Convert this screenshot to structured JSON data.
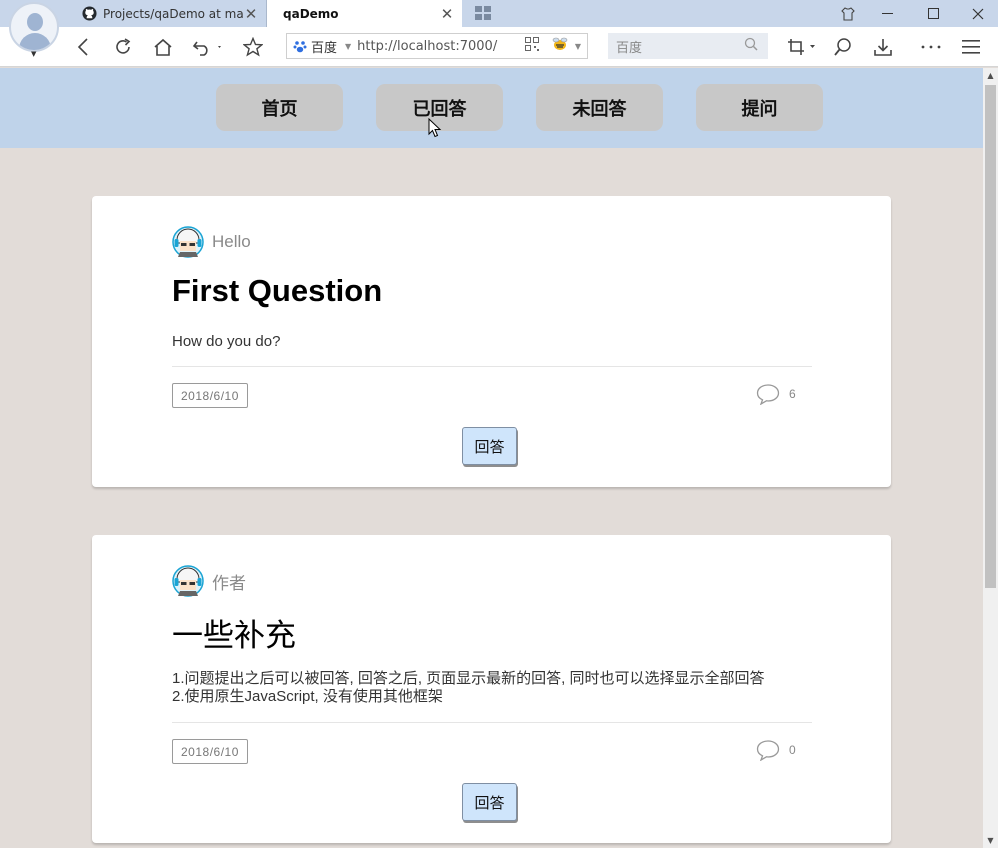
{
  "browser": {
    "tabs": [
      {
        "label": "Projects/qaDemo at mas...",
        "icon": "github-icon",
        "active": false
      },
      {
        "label": "qaDemo",
        "icon": "none",
        "active": true
      }
    ],
    "address": {
      "engine": "百度",
      "url": "http://localhost:7000/"
    },
    "search": {
      "placeholder": "百度"
    }
  },
  "nav": {
    "items": [
      {
        "label": "首页"
      },
      {
        "label": "已回答"
      },
      {
        "label": "未回答"
      },
      {
        "label": "提问"
      }
    ]
  },
  "questions": [
    {
      "author": "Hello",
      "title": "First Question",
      "content": [
        "How do you do?"
      ],
      "date": "2018/6/10",
      "comment_count": "6",
      "answer_label": "回答"
    },
    {
      "author": "作者",
      "title": "一些补充",
      "content": [
        "1.问题提出之后可以被回答, 回答之后, 页面显示最新的回答, 同时也可以选择显示全部回答",
        "2.使用原生JavaScript, 没有使用其他框架"
      ],
      "date": "2018/6/10",
      "comment_count": "0",
      "answer_label": "回答"
    }
  ],
  "colors": {
    "nav_bg": "#bfd3ea",
    "nav_button": "#c8c8c8",
    "page_bg": "#e2dcd8",
    "answer_button": "#cfe5fb"
  }
}
